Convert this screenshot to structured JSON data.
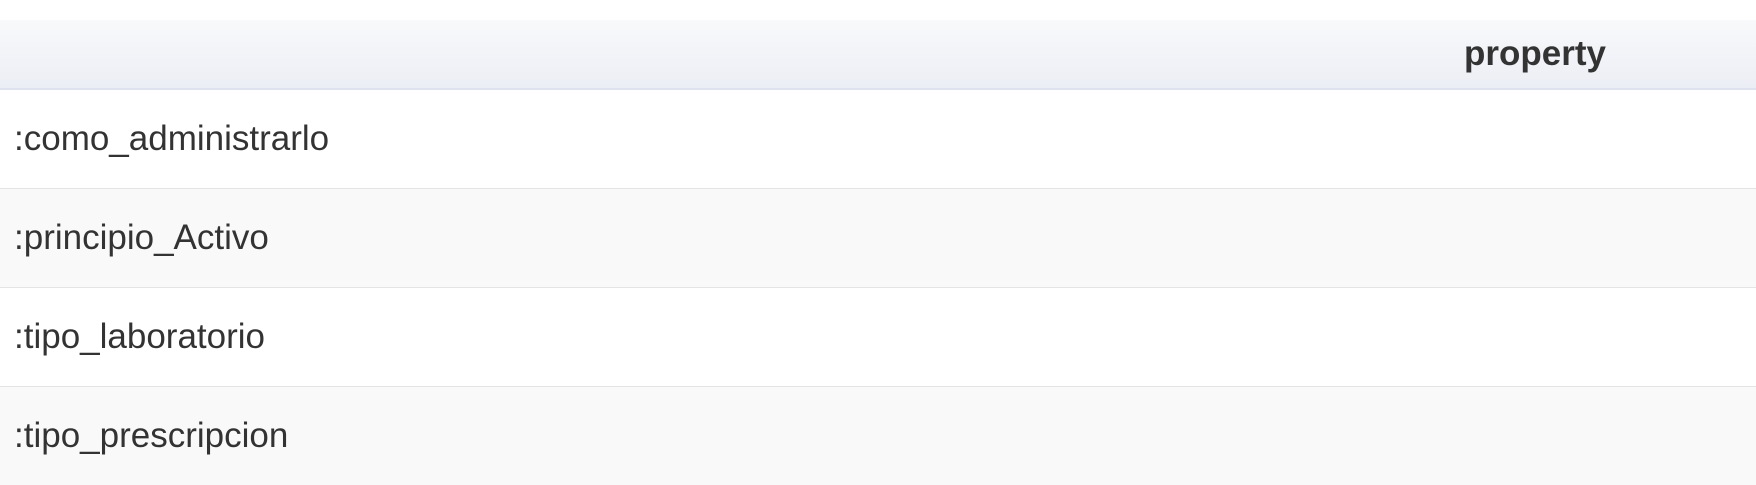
{
  "table": {
    "header": {
      "column": "property"
    },
    "rows": [
      ":como_administrarlo",
      ":principio_Activo",
      ":tipo_laboratorio",
      ":tipo_prescripcion"
    ]
  }
}
